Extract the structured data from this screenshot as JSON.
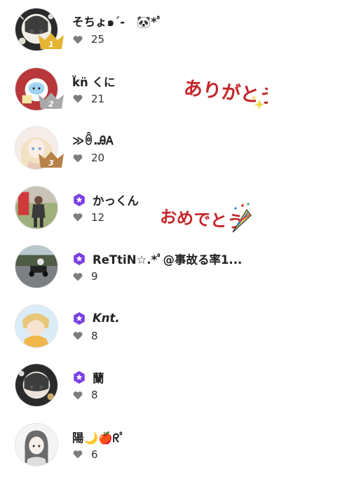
{
  "ranking": [
    {
      "rank": 1,
      "rank_label": "1",
      "name": "そちょ๑´-　🐼*ﾟ",
      "likes": "25",
      "verified": false,
      "avatar": "ink-flower-portrait"
    },
    {
      "rank": 2,
      "rank_label": "2",
      "name": "k̈n̈ くに",
      "likes": "21",
      "verified": false,
      "avatar": "red-cloud-character"
    },
    {
      "rank": 3,
      "rank_label": "3",
      "name": "≫ꉺ.ᎯᎪ",
      "likes": "20",
      "verified": false,
      "avatar": "anime-girl-pastel"
    },
    {
      "rank": 4,
      "rank_label": "",
      "name": "かっくん",
      "likes": "12",
      "verified": true,
      "avatar": "person-outdoor"
    },
    {
      "rank": 5,
      "rank_label": "",
      "name": "ReTtiN☆.*ﾟ@事故る率1...",
      "likes": "9",
      "verified": true,
      "avatar": "go-kart-track"
    },
    {
      "rank": 6,
      "rank_label": "",
      "name": "Knt.",
      "likes": "8",
      "verified": true,
      "avatar": "anime-boy-blue"
    },
    {
      "rank": 7,
      "rank_label": "",
      "name": "蘭",
      "likes": "8",
      "verified": true,
      "avatar": "ink-flower-portrait"
    },
    {
      "rank": 8,
      "rank_label": "",
      "name": "陽🌙🍎ᖇﾟ",
      "likes": "6",
      "verified": false,
      "avatar": "girl-sketch"
    }
  ],
  "stickers": [
    {
      "text": "ありがとう",
      "color": "#c3272b",
      "icon": "sparkle-icon"
    },
    {
      "text": "おめでとう",
      "color": "#c3272b",
      "icon": "party-popper-icon"
    }
  ],
  "colors": {
    "gold": "#e3b532",
    "silver": "#a9a9a9",
    "bronze": "#b98248",
    "verified": "#7b3fe0",
    "heart": "#7d7d7d"
  }
}
